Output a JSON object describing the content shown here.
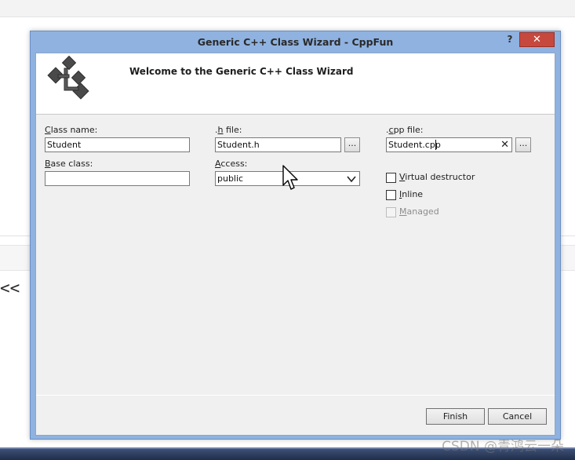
{
  "window": {
    "title": "Generic C++ Class Wizard - CppFun",
    "help_label": "?",
    "close_label": "✕"
  },
  "header": {
    "text": "Welcome to the Generic C++ Class Wizard"
  },
  "form": {
    "class_name": {
      "label_mnemonic": "C",
      "label_rest": "lass name:",
      "value": "Student"
    },
    "h_file": {
      "label_pre": ".",
      "label_mnemonic": "h",
      "label_rest": " file:",
      "value": "Student.h",
      "browse_label": "..."
    },
    "cpp_file": {
      "label_pre": ".",
      "label_mnemonic": "c",
      "label_rest": "pp file:",
      "value": "Student.cpp",
      "browse_label": "...",
      "clear_label": "✕"
    },
    "base_class": {
      "label_mnemonic": "B",
      "label_rest": "ase class:",
      "value": ""
    },
    "access": {
      "label_mnemonic": "A",
      "label_rest": "ccess:",
      "value": "public"
    },
    "options": [
      {
        "mnemonic": "V",
        "rest": "irtual destructor",
        "checked": false,
        "enabled": true
      },
      {
        "mnemonic": "I",
        "rest": "nline",
        "checked": false,
        "enabled": true
      },
      {
        "mnemonic": "M",
        "rest": "anaged",
        "checked": false,
        "enabled": false
      }
    ]
  },
  "buttons": {
    "finish": "Finish",
    "cancel": "Cancel"
  },
  "background": {
    "code_fragment": "<< ",
    "watermark": "CSDN @青鸿云一朵"
  },
  "colors": {
    "dialog_frame": "#8fb2e0",
    "close_button": "#c7493d",
    "client_bg": "#f0f0f0"
  }
}
